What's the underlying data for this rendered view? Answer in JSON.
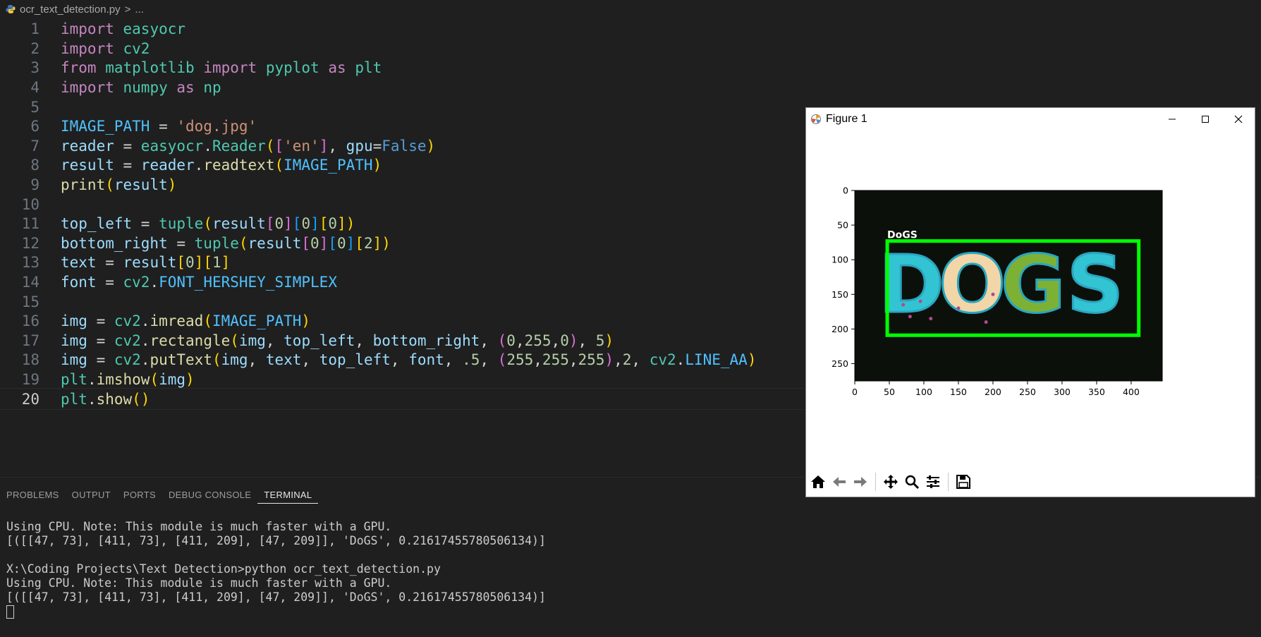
{
  "breadcrumb": {
    "file": "ocr_text_detection.py",
    "separator": ">",
    "more": "..."
  },
  "editor": {
    "current_line": 20,
    "lines": [
      {
        "n": "1"
      },
      {
        "n": "2"
      },
      {
        "n": "3"
      },
      {
        "n": "4"
      },
      {
        "n": "5"
      },
      {
        "n": "6"
      },
      {
        "n": "7"
      },
      {
        "n": "8"
      },
      {
        "n": "9"
      },
      {
        "n": "10"
      },
      {
        "n": "11"
      },
      {
        "n": "12"
      },
      {
        "n": "13"
      },
      {
        "n": "14"
      },
      {
        "n": "15"
      },
      {
        "n": "16"
      },
      {
        "n": "17"
      },
      {
        "n": "18"
      },
      {
        "n": "19"
      },
      {
        "n": "20"
      }
    ],
    "code": [
      [
        [
          "kw",
          "import"
        ],
        [
          "op",
          " "
        ],
        [
          "cls",
          "easyocr"
        ]
      ],
      [
        [
          "kw",
          "import"
        ],
        [
          "op",
          " "
        ],
        [
          "cls",
          "cv2"
        ]
      ],
      [
        [
          "kw",
          "from"
        ],
        [
          "op",
          " "
        ],
        [
          "cls",
          "matplotlib"
        ],
        [
          "op",
          " "
        ],
        [
          "kw",
          "import"
        ],
        [
          "op",
          " "
        ],
        [
          "cls",
          "pyplot"
        ],
        [
          "op",
          " "
        ],
        [
          "kw",
          "as"
        ],
        [
          "op",
          " "
        ],
        [
          "cls",
          "plt"
        ]
      ],
      [
        [
          "kw",
          "import"
        ],
        [
          "op",
          " "
        ],
        [
          "cls",
          "numpy"
        ],
        [
          "op",
          " "
        ],
        [
          "kw",
          "as"
        ],
        [
          "op",
          " "
        ],
        [
          "cls",
          "np"
        ]
      ],
      [],
      [
        [
          "const",
          "IMAGE_PATH"
        ],
        [
          "op",
          " = "
        ],
        [
          "str",
          "'dog.jpg'"
        ]
      ],
      [
        [
          "var",
          "reader"
        ],
        [
          "op",
          " = "
        ],
        [
          "cls",
          "easyocr"
        ],
        [
          "op",
          "."
        ],
        [
          "cls",
          "Reader"
        ],
        [
          "b1",
          "("
        ],
        [
          "b2",
          "["
        ],
        [
          "str",
          "'en'"
        ],
        [
          "b2",
          "]"
        ],
        [
          "op",
          ", "
        ],
        [
          "var",
          "gpu"
        ],
        [
          "op",
          "="
        ],
        [
          "bool",
          "False"
        ],
        [
          "b1",
          ")"
        ]
      ],
      [
        [
          "var",
          "result"
        ],
        [
          "op",
          " = "
        ],
        [
          "var",
          "reader"
        ],
        [
          "op",
          "."
        ],
        [
          "fn",
          "readtext"
        ],
        [
          "b1",
          "("
        ],
        [
          "const",
          "IMAGE_PATH"
        ],
        [
          "b1",
          ")"
        ]
      ],
      [
        [
          "fn",
          "print"
        ],
        [
          "b1",
          "("
        ],
        [
          "var",
          "result"
        ],
        [
          "b1",
          ")"
        ]
      ],
      [],
      [
        [
          "var",
          "top_left"
        ],
        [
          "op",
          " = "
        ],
        [
          "cls",
          "tuple"
        ],
        [
          "b1",
          "("
        ],
        [
          "var",
          "result"
        ],
        [
          "b2",
          "["
        ],
        [
          "num",
          "0"
        ],
        [
          "b2",
          "]"
        ],
        [
          "b3",
          "["
        ],
        [
          "num",
          "0"
        ],
        [
          "b3",
          "]"
        ],
        [
          "b1",
          "["
        ],
        [
          "num",
          "0"
        ],
        [
          "b1",
          "]"
        ],
        [
          "b1",
          ")"
        ]
      ],
      [
        [
          "var",
          "bottom_right"
        ],
        [
          "op",
          " = "
        ],
        [
          "cls",
          "tuple"
        ],
        [
          "b1",
          "("
        ],
        [
          "var",
          "result"
        ],
        [
          "b2",
          "["
        ],
        [
          "num",
          "0"
        ],
        [
          "b2",
          "]"
        ],
        [
          "b3",
          "["
        ],
        [
          "num",
          "0"
        ],
        [
          "b3",
          "]"
        ],
        [
          "b1",
          "["
        ],
        [
          "num",
          "2"
        ],
        [
          "b1",
          "]"
        ],
        [
          "b1",
          ")"
        ]
      ],
      [
        [
          "var",
          "text"
        ],
        [
          "op",
          " = "
        ],
        [
          "var",
          "result"
        ],
        [
          "b1",
          "["
        ],
        [
          "num",
          "0"
        ],
        [
          "b1",
          "]"
        ],
        [
          "b1",
          "["
        ],
        [
          "num",
          "1"
        ],
        [
          "b1",
          "]"
        ]
      ],
      [
        [
          "var",
          "font"
        ],
        [
          "op",
          " = "
        ],
        [
          "cls",
          "cv2"
        ],
        [
          "op",
          "."
        ],
        [
          "const",
          "FONT_HERSHEY_SIMPLEX"
        ]
      ],
      [],
      [
        [
          "var",
          "img"
        ],
        [
          "op",
          " = "
        ],
        [
          "cls",
          "cv2"
        ],
        [
          "op",
          "."
        ],
        [
          "fn",
          "imread"
        ],
        [
          "b1",
          "("
        ],
        [
          "const",
          "IMAGE_PATH"
        ],
        [
          "b1",
          ")"
        ]
      ],
      [
        [
          "var",
          "img"
        ],
        [
          "op",
          " = "
        ],
        [
          "cls",
          "cv2"
        ],
        [
          "op",
          "."
        ],
        [
          "fn",
          "rectangle"
        ],
        [
          "b1",
          "("
        ],
        [
          "var",
          "img"
        ],
        [
          "op",
          ", "
        ],
        [
          "var",
          "top_left"
        ],
        [
          "op",
          ", "
        ],
        [
          "var",
          "bottom_right"
        ],
        [
          "op",
          ", "
        ],
        [
          "b2",
          "("
        ],
        [
          "num",
          "0"
        ],
        [
          "op",
          ","
        ],
        [
          "num",
          "255"
        ],
        [
          "op",
          ","
        ],
        [
          "num",
          "0"
        ],
        [
          "b2",
          ")"
        ],
        [
          "op",
          ", "
        ],
        [
          "num",
          "5"
        ],
        [
          "b1",
          ")"
        ]
      ],
      [
        [
          "var",
          "img"
        ],
        [
          "op",
          " = "
        ],
        [
          "cls",
          "cv2"
        ],
        [
          "op",
          "."
        ],
        [
          "fn",
          "putText"
        ],
        [
          "b1",
          "("
        ],
        [
          "var",
          "img"
        ],
        [
          "op",
          ", "
        ],
        [
          "var",
          "text"
        ],
        [
          "op",
          ", "
        ],
        [
          "var",
          "top_left"
        ],
        [
          "op",
          ", "
        ],
        [
          "var",
          "font"
        ],
        [
          "op",
          ", "
        ],
        [
          "num",
          ".5"
        ],
        [
          "op",
          ", "
        ],
        [
          "b2",
          "("
        ],
        [
          "num",
          "255"
        ],
        [
          "op",
          ","
        ],
        [
          "num",
          "255"
        ],
        [
          "op",
          ","
        ],
        [
          "num",
          "255"
        ],
        [
          "b2",
          ")"
        ],
        [
          "op",
          ","
        ],
        [
          "num",
          "2"
        ],
        [
          "op",
          ", "
        ],
        [
          "cls",
          "cv2"
        ],
        [
          "op",
          "."
        ],
        [
          "const",
          "LINE_AA"
        ],
        [
          "b1",
          ")"
        ]
      ],
      [
        [
          "cls",
          "plt"
        ],
        [
          "op",
          "."
        ],
        [
          "fn",
          "imshow"
        ],
        [
          "b1",
          "("
        ],
        [
          "var",
          "img"
        ],
        [
          "b1",
          ")"
        ]
      ],
      [
        [
          "cls",
          "plt"
        ],
        [
          "op",
          "."
        ],
        [
          "fn",
          "show"
        ],
        [
          "b1",
          "("
        ],
        [
          "b1",
          ")"
        ]
      ]
    ]
  },
  "panel": {
    "tabs": [
      "PROBLEMS",
      "OUTPUT",
      "PORTS",
      "DEBUG CONSOLE",
      "TERMINAL"
    ],
    "active_tab": "TERMINAL",
    "terminal_lines": [
      "Using CPU. Note: This module is much faster with a GPU.",
      "[([[47, 73], [411, 73], [411, 209], [47, 209]], 'DoGS', 0.21617455780506134)]",
      "",
      "X:\\Coding Projects\\Text Detection>python ocr_text_detection.py",
      "Using CPU. Note: This module is much faster with a GPU.",
      "[([[47, 73], [411, 73], [411, 209], [47, 209]], 'DoGS', 0.21617455780506134)]"
    ]
  },
  "figure": {
    "title": "Figure 1",
    "image_label": "DoGS",
    "image_text": "DOGS",
    "chart_data": {
      "type": "image",
      "title": "",
      "xlabel": "",
      "ylabel": "",
      "xlim": [
        0,
        445
      ],
      "ylim": [
        0,
        275
      ],
      "xticks": [
        "0",
        "50",
        "100",
        "150",
        "200",
        "250",
        "300",
        "350",
        "400"
      ],
      "yticks": [
        "0",
        "50",
        "100",
        "150",
        "200",
        "250"
      ],
      "box": {
        "x0": 47,
        "y0": 73,
        "x1": 411,
        "y1": 209
      },
      "box_color": "#00ff00"
    },
    "toolbar": [
      "home-icon",
      "back-icon",
      "forward-icon",
      "pan-icon",
      "zoom-icon",
      "configure-icon",
      "save-icon"
    ]
  },
  "colors": {
    "bg": "#1f1f1f",
    "keyword": "#c586c0",
    "variable": "#9cdcfe",
    "class": "#4ec9b0",
    "string": "#ce9178",
    "number": "#b5cea8"
  }
}
